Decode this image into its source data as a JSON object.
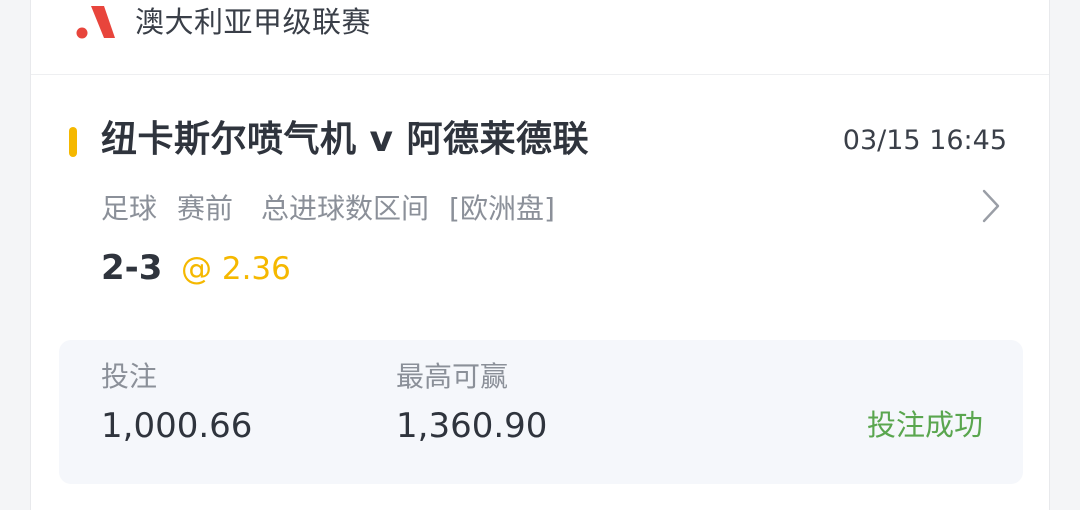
{
  "league": {
    "name": "澳大利亚甲级联赛",
    "logo_icon": "brand-logo-icon",
    "logo_color": "#e8453c"
  },
  "match": {
    "title": "纽卡斯尔喷气机 v 阿德莱德联",
    "time": "03/15 16:45",
    "sport": "足球",
    "stage": "赛前",
    "market": "总进球数区间",
    "odds_type": "[欧洲盘]",
    "selection": "2-3",
    "odds": "@ 2.36",
    "accent_color": "#f5b800"
  },
  "bet": {
    "stake_label": "投注",
    "stake_value": "1,000.66",
    "max_win_label": "最高可赢",
    "max_win_value": "1,360.90",
    "status": "投注成功",
    "status_color": "#5aa64f"
  }
}
